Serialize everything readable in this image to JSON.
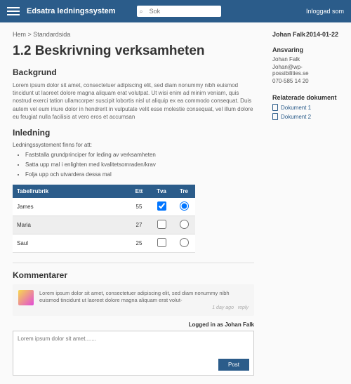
{
  "header": {
    "brand": "Edsatra ledningssystem",
    "searchPlaceholder": "Sok",
    "loginStatus": "Inloggad som"
  },
  "breadcrumb": "Hem > Standardsida",
  "title": "1.2 Beskrivning verksamheten",
  "sections": {
    "bg_h": "Backgrund",
    "bg_body": "Lorem ipsum dolor sit amet, consectetuer adipiscing elit, sed diam nonummy nibh euismod tincidunt ut laoreet dolore magna aliquam erat volutpat. Ut wisi enim ad minim veniam, quis nostrud exerci tation ullamcorper suscipit lobortis nisl ut aliquip ex ea commodo consequat. Duis autem vel eum iriure dolor in hendrerit in vulputate velit esse molestie consequat, vel illum dolore eu feugiat nulla facilisis at vero eros et accumsan",
    "in_h": "Inledning",
    "in_lead": "Ledningssystement finns for att:",
    "bullets": [
      "Faststalla grundprinciper for leding av verksamheten",
      "Satta upp mal i enlighten med kvalitetsomraden/krav",
      "Folja upp och utvardera dessa mal"
    ]
  },
  "table": {
    "headers": [
      "Tabellrubrik",
      "Ett",
      "Tva",
      "Tre"
    ],
    "rows": [
      {
        "name": "James",
        "ett": "55",
        "tva_checked": true,
        "tre_selected": true
      },
      {
        "name": "Maria",
        "ett": "27",
        "tva_checked": false,
        "tre_selected": false,
        "selected": true
      },
      {
        "name": "Saul",
        "ett": "25",
        "tva_checked": false,
        "tre_selected": false
      }
    ]
  },
  "comments": {
    "heading": "Kommentarer",
    "item_body": "Lorem ipsum dolor sit amet, consectetuer adipiscing elit, sed diam nonummy nibh euismod tincidunt ut laoreet dolore magna aliquam erat volut-",
    "item_time": "1 day ago",
    "item_reply": "reply",
    "logged_as": "Logged in as Johan Falk",
    "placeholder": "Lorem ipsum dolor sit amet.......",
    "post": "Post"
  },
  "sidebar": {
    "author": "Johan Falk",
    "date": "2014-01-22",
    "resp_h": "Ansvaring",
    "resp_name": "Johan Falk",
    "resp_email": "Johan@wp-possibilities.se",
    "resp_phone": "070-585 14 20",
    "docs_h": "Relaterade dokument",
    "docs": [
      "Dokument 1",
      "Dokument 2"
    ]
  }
}
